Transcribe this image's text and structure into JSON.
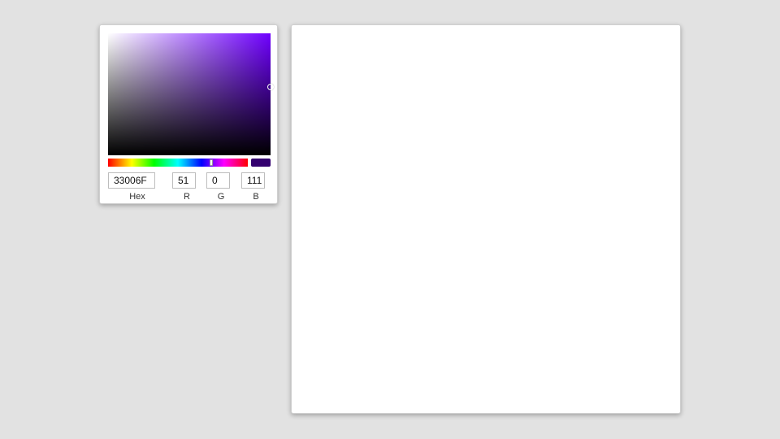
{
  "picker": {
    "hue_color": "#6f00ff",
    "saturation": 1.0,
    "value": 0.56,
    "hue_position": 0.74,
    "swatch_color": "#33006f",
    "fields": {
      "hex": {
        "label": "Hex",
        "value": "33006F"
      },
      "r": {
        "label": "R",
        "value": "51"
      },
      "g": {
        "label": "G",
        "value": "0"
      },
      "b": {
        "label": "B",
        "value": "111"
      }
    }
  },
  "colors": {
    "background": "#e2e2e2",
    "panel": "#ffffff"
  }
}
